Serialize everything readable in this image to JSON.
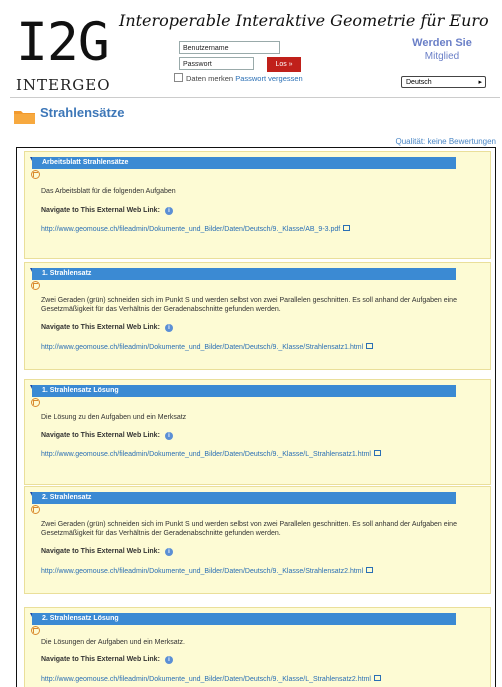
{
  "header": {
    "logo_big": "I2G",
    "logo_small": "INTERGEO",
    "site_title": "Interoperable Interaktive Geometrie für Euro",
    "username_placeholder": "Benutzername",
    "password_placeholder": "Passwort",
    "login_button": "Los »",
    "remember_label": "Daten merken",
    "forgot_password": "Passwort vergessen",
    "member_line1": "Werden Sie",
    "member_line2": "Mitglied",
    "language": "Deutsch"
  },
  "page": {
    "title": "Strahlensätze",
    "quality": "Qualität: keine Bewertungen"
  },
  "resources": [
    {
      "title": "Arbeitsblatt Strahlensätze",
      "description": "Das Arbeitsblatt für die folgenden Aufgaben",
      "nav_label": "Navigate to This External Web Link:",
      "url": "http://www.geomouse.ch/fileadmin/Dokumente_und_Bilder/Daten/Deutsch/9._Klasse/AB_9-3.pdf"
    },
    {
      "title": "1. Strahlensatz",
      "description": "Zwei Geraden (grün) schneiden sich im Punkt S und werden selbst von zwei Parallelen geschnitten. Es soll anhand der Aufgaben eine Gesetzmäßigkeit für das Verhältnis der Geradenabschnitte gefunden werden.",
      "nav_label": "Navigate to This External Web Link:",
      "url": "http://www.geomouse.ch/fileadmin/Dokumente_und_Bilder/Daten/Deutsch/9._Klasse/Strahlensatz1.html"
    },
    {
      "title": "1. Strahlensatz Lösung",
      "description": "Die Lösung zu den Aufgaben und ein Merksatz",
      "nav_label": "Navigate to This External Web Link:",
      "url": "http://www.geomouse.ch/fileadmin/Dokumente_und_Bilder/Daten/Deutsch/9._Klasse/L_Strahlensatz1.html"
    },
    {
      "title": "2. Strahlensatz",
      "description": "Zwei Geraden (grün) schneiden sich im Punkt S und werden selbst von zwei Parallelen geschnitten. Es soll anhand der Aufgaben eine Gesetzmäßigkeit für das Verhältnis der Geradenabschnitte gefunden werden.",
      "nav_label": "Navigate to This External Web Link:",
      "url": "http://www.geomouse.ch/fileadmin/Dokumente_und_Bilder/Daten/Deutsch/9._Klasse/Strahlensatz2.html"
    },
    {
      "title": "2. Strahlensatz Lösung",
      "description": "Die Lösungen der Aufgaben und ein Merksatz.",
      "nav_label": "Navigate to This External Web Link:",
      "url": "http://www.geomouse.ch/fileadmin/Dokumente_und_Bilder/Daten/Deutsch/9._Klasse/L_Strahlensatz2.html"
    }
  ],
  "colors": {
    "accent_blue": "#3b8ad3",
    "title_blue": "#3d77b8",
    "login_red": "#c0201a",
    "card_bg": "#fdfbd4"
  }
}
